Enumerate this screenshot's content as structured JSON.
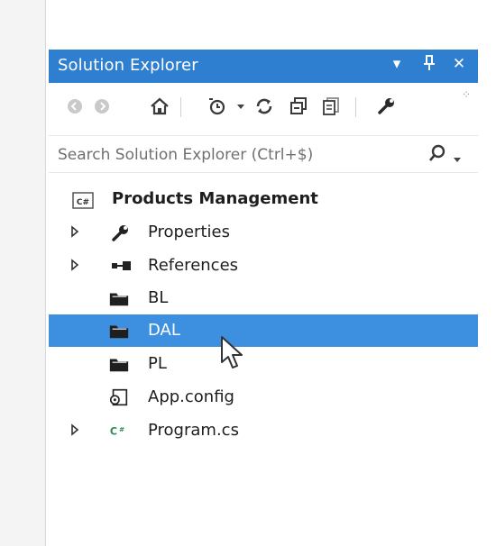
{
  "window": {
    "title": "Solution Explorer",
    "controls": {
      "dropdown": "▾",
      "pin": "⊥",
      "close": "✕"
    }
  },
  "toolbar": {
    "overflow": "⁘",
    "buttons": [
      {
        "name": "back-icon"
      },
      {
        "name": "forward-icon"
      },
      {
        "name": "home-icon"
      },
      {
        "name": "pending-changes-filter-icon"
      },
      {
        "name": "sync-icon"
      },
      {
        "name": "collapse-all-icon"
      },
      {
        "name": "show-all-files-icon"
      },
      {
        "name": "properties-wrench-icon"
      }
    ]
  },
  "search": {
    "placeholder": "Search Solution Explorer (Ctrl+$)",
    "value": ""
  },
  "tree": {
    "project": {
      "label": "Products Management",
      "icon": "csharp-project-icon"
    },
    "items": [
      {
        "label": "Properties",
        "icon": "wrench-icon",
        "expandable": true
      },
      {
        "label": "References",
        "icon": "references-icon",
        "expandable": true
      },
      {
        "label": "BL",
        "icon": "folder-icon",
        "expandable": false
      },
      {
        "label": "DAL",
        "icon": "folder-icon",
        "expandable": false,
        "selected": true
      },
      {
        "label": "PL",
        "icon": "folder-icon",
        "expandable": false
      },
      {
        "label": "App.config",
        "icon": "config-icon",
        "expandable": false
      },
      {
        "label": "Program.cs",
        "icon": "csharp-file-icon",
        "expandable": true
      }
    ]
  },
  "colors": {
    "title_bar": "#2f7fd0",
    "selection": "#3d8fe0"
  }
}
